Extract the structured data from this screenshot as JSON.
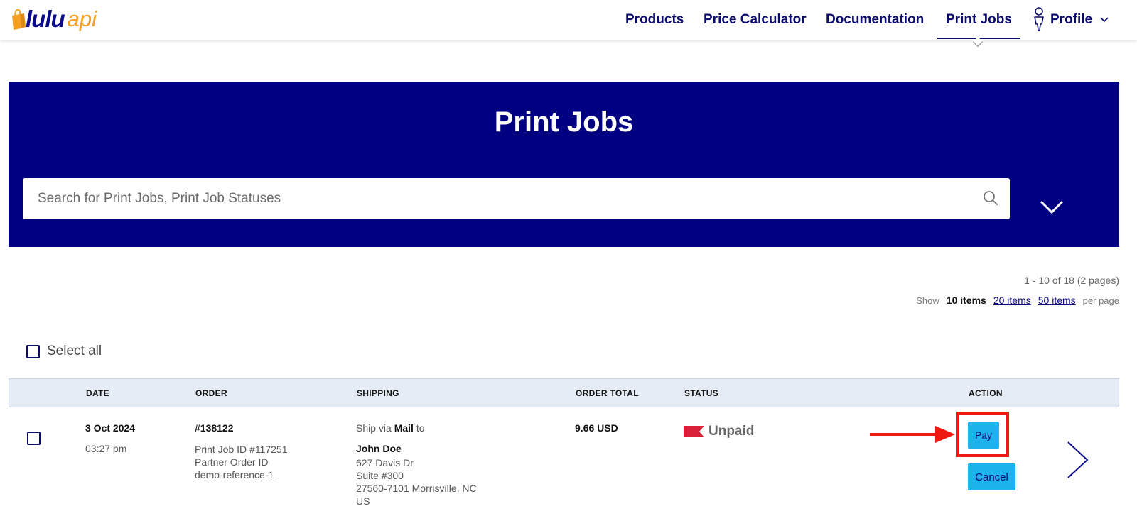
{
  "brand": {
    "name": "lulu",
    "suffix": "api",
    "colors": {
      "navy": "#0b0b6e",
      "hero": "#000080",
      "accent": "#f5a020",
      "button": "#1db3ec",
      "highlight": "#ee1a12",
      "unpaid_flag": "#d9213a"
    }
  },
  "nav": {
    "items": [
      "Products",
      "Price Calculator",
      "Documentation",
      "Print Jobs"
    ],
    "active": "Print Jobs",
    "profile_label": "Profile"
  },
  "hero": {
    "title": "Print Jobs",
    "search_placeholder": "Search for Print Jobs, Print Job Statuses"
  },
  "pagination": {
    "summary": "1 - 10 of 18 (2 pages)",
    "show_label": "Show",
    "current": "10 items",
    "options": [
      "20 items",
      "50 items"
    ],
    "per_page_label": "per page"
  },
  "select_all_label": "Select all",
  "table": {
    "headers": [
      "DATE",
      "ORDER",
      "SHIPPING",
      "ORDER TOTAL",
      "STATUS",
      "ACTION"
    ],
    "rows": [
      {
        "date": "3 Oct 2024",
        "time": "03:27 pm",
        "order_number": "#138122",
        "print_job_id": "Print Job ID #117251",
        "partner_order_label": "Partner Order ID",
        "partner_order_id": "demo-reference-1",
        "ship_prefix": "Ship via",
        "ship_method": "Mail",
        "ship_suffix": "to",
        "recipient": "John Doe",
        "address_lines": [
          "627 Davis Dr",
          "Suite #300",
          "27560-7101 Morrisville, NC",
          "US"
        ],
        "total": "9.66 USD",
        "status": "Unpaid",
        "actions": [
          "Pay",
          "Cancel"
        ]
      }
    ]
  }
}
